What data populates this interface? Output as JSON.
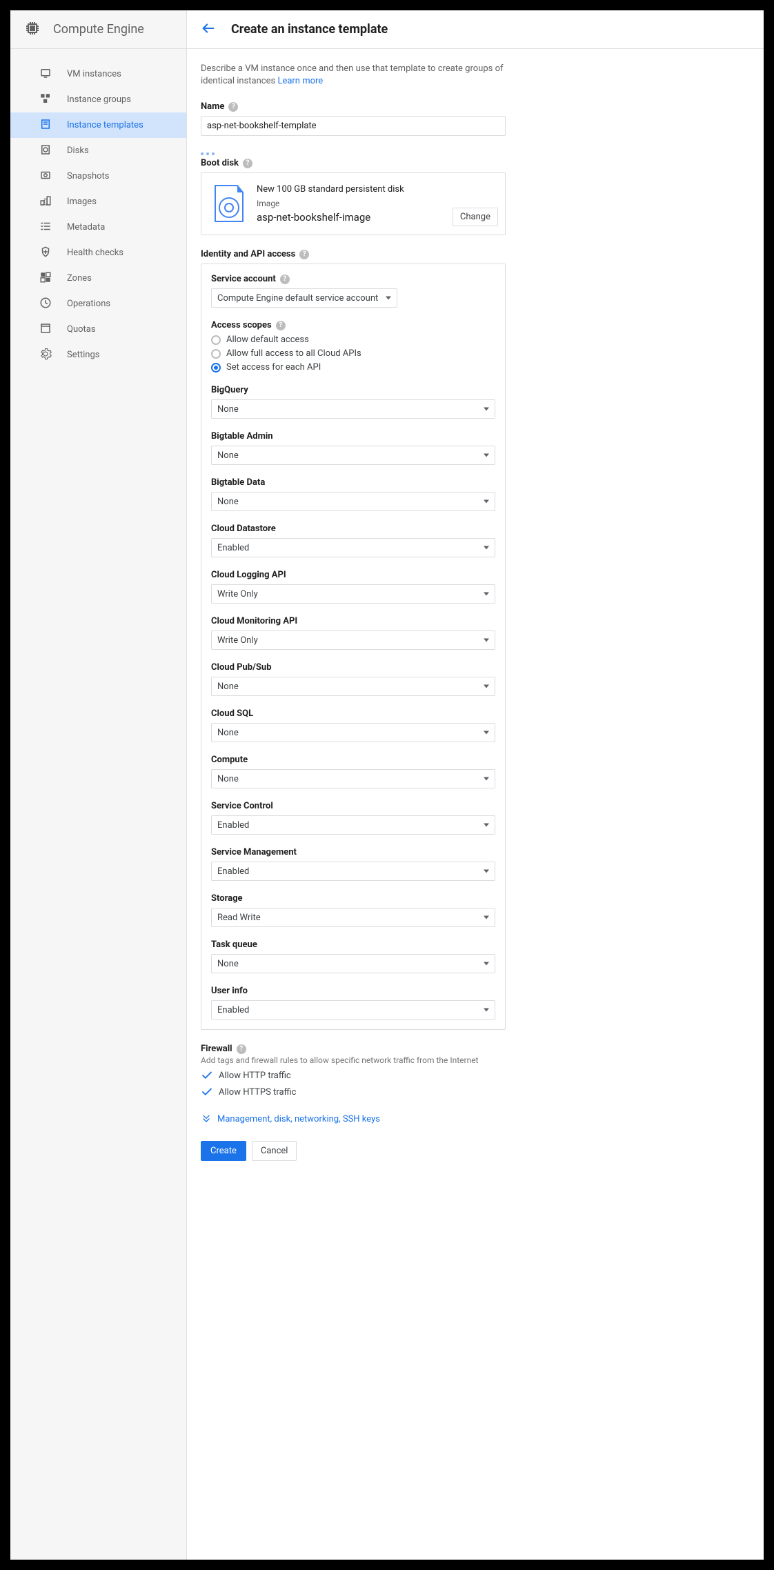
{
  "sidebar": {
    "title": "Compute Engine",
    "items": [
      {
        "label": "VM instances",
        "icon": "vm"
      },
      {
        "label": "Instance groups",
        "icon": "groups"
      },
      {
        "label": "Instance templates",
        "icon": "template",
        "active": true
      },
      {
        "label": "Disks",
        "icon": "disk"
      },
      {
        "label": "Snapshots",
        "icon": "snapshot"
      },
      {
        "label": "Images",
        "icon": "image"
      },
      {
        "label": "Metadata",
        "icon": "metadata"
      },
      {
        "label": "Health checks",
        "icon": "health"
      },
      {
        "label": "Zones",
        "icon": "zones"
      },
      {
        "label": "Operations",
        "icon": "operations"
      },
      {
        "label": "Quotas",
        "icon": "quotas"
      },
      {
        "label": "Settings",
        "icon": "settings"
      }
    ]
  },
  "header": {
    "title": "Create an instance template"
  },
  "description": {
    "text": "Describe a VM instance once and then use that template to create groups of identical instances ",
    "link": "Learn more"
  },
  "name": {
    "label": "Name",
    "value": "asp-net-bookshelf-template"
  },
  "boot_disk": {
    "label": "Boot disk",
    "summary": "New 100 GB standard persistent disk",
    "image_label": "Image",
    "image_name": "asp-net-bookshelf-image",
    "change": "Change"
  },
  "identity": {
    "label": "Identity and API access",
    "service_account": {
      "label": "Service account",
      "value": "Compute Engine default service account"
    },
    "access_scopes": {
      "label": "Access scopes",
      "options": [
        {
          "label": "Allow default access",
          "checked": false
        },
        {
          "label": "Allow full access to all Cloud APIs",
          "checked": false
        },
        {
          "label": "Set access for each API",
          "checked": true
        }
      ]
    },
    "apis": [
      {
        "label": "BigQuery",
        "value": "None"
      },
      {
        "label": "Bigtable Admin",
        "value": "None"
      },
      {
        "label": "Bigtable Data",
        "value": "None"
      },
      {
        "label": "Cloud Datastore",
        "value": "Enabled"
      },
      {
        "label": "Cloud Logging API",
        "value": "Write Only"
      },
      {
        "label": "Cloud Monitoring API",
        "value": "Write Only"
      },
      {
        "label": "Cloud Pub/Sub",
        "value": "None"
      },
      {
        "label": "Cloud SQL",
        "value": "None"
      },
      {
        "label": "Compute",
        "value": "None"
      },
      {
        "label": "Service Control",
        "value": "Enabled"
      },
      {
        "label": "Service Management",
        "value": "Enabled"
      },
      {
        "label": "Storage",
        "value": "Read Write"
      },
      {
        "label": "Task queue",
        "value": "None"
      },
      {
        "label": "User info",
        "value": "Enabled"
      }
    ]
  },
  "firewall": {
    "label": "Firewall",
    "description": "Add tags and firewall rules to allow specific network traffic from the Internet",
    "checks": [
      {
        "label": "Allow HTTP traffic",
        "checked": true
      },
      {
        "label": "Allow HTTPS traffic",
        "checked": true
      }
    ]
  },
  "expand": {
    "label": "Management, disk, networking, SSH keys"
  },
  "buttons": {
    "create": "Create",
    "cancel": "Cancel"
  }
}
